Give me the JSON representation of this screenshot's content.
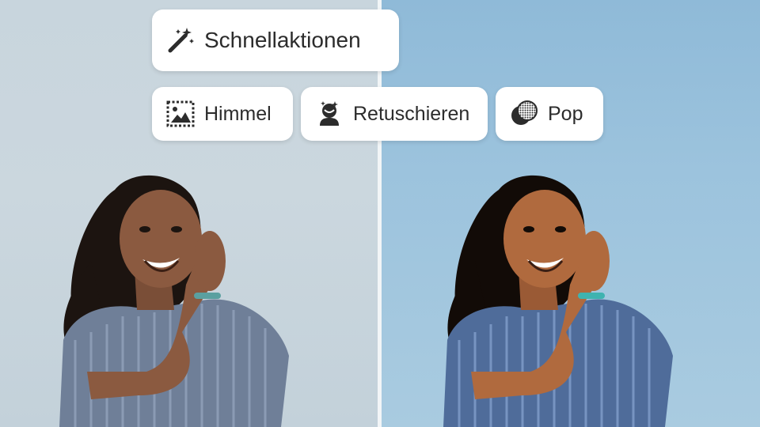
{
  "quick_actions": {
    "title": "Schnellaktionen",
    "title_icon": "magic-wand-icon",
    "items": [
      {
        "label": "Himmel",
        "icon": "sky-replace-icon"
      },
      {
        "label": "Retuschieren",
        "icon": "retouch-face-icon"
      },
      {
        "label": "Pop",
        "icon": "pop-circles-icon"
      }
    ]
  },
  "comparison": {
    "before_tint": "#c9d6de",
    "after_tint": "#9cc3dd",
    "divider_color": "#f2f5f7"
  }
}
